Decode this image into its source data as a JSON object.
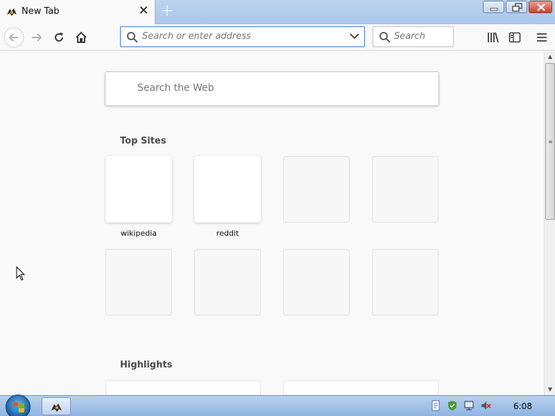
{
  "tab": {
    "title": "New Tab"
  },
  "nav": {
    "url_placeholder": "Search or enter address",
    "search_placeholder": "Search"
  },
  "content": {
    "web_search_placeholder": "Search the Web",
    "top_sites_title": "Top Sites",
    "top_sites": [
      {
        "label": "wikipedia"
      },
      {
        "label": "reddit"
      },
      {
        "label": ""
      },
      {
        "label": ""
      },
      {
        "label": ""
      },
      {
        "label": ""
      },
      {
        "label": ""
      },
      {
        "label": ""
      }
    ],
    "highlights_title": "Highlights"
  },
  "taskbar": {
    "clock": "6:08"
  },
  "colors": {
    "accent": "#3d7bd8",
    "page_bg": "#f9f9fa",
    "taskbar": "#a9c6ea"
  },
  "icons": [
    "back-icon",
    "forward-icon",
    "reload-icon",
    "home-icon",
    "search-icon",
    "chevron-down-icon",
    "library-icon",
    "sidebar-icon",
    "menu-icon",
    "close-icon",
    "new-tab-icon"
  ]
}
